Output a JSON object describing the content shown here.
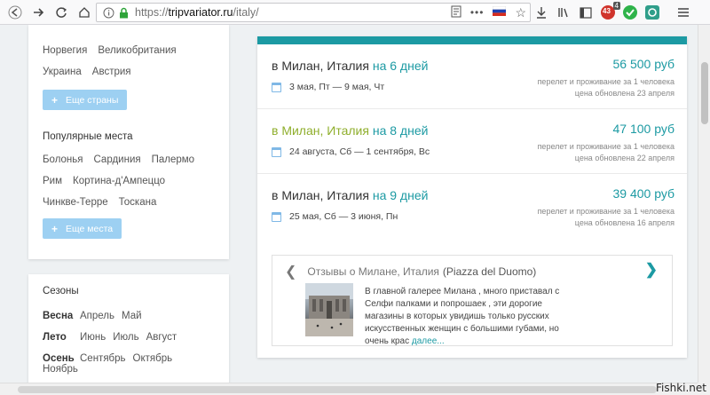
{
  "browser": {
    "url_prefix": "https://",
    "url_domain": "tripvariator.ru",
    "url_path": "/italy/",
    "badge": "4",
    "addon_count": "43"
  },
  "sidebar": {
    "countries_row1": [
      "Норвегия",
      "Великобритания"
    ],
    "countries_row2": [
      "Украина",
      "Австрия"
    ],
    "more_countries": "Еще страны",
    "popular_title": "Популярные места",
    "places_row1": [
      "Болонья",
      "Сардиния",
      "Палермо"
    ],
    "places_row2": [
      "Рим",
      "Кортина-д'Ампеццо"
    ],
    "places_row3": [
      "Чинкве-Терре",
      "Тоскана"
    ],
    "more_places": "Еще места",
    "seasons_title": "Сезоны",
    "seasons": [
      {
        "name": "Весна",
        "months": [
          "Апрель",
          "Май"
        ]
      },
      {
        "name": "Лето",
        "months": [
          "Июнь",
          "Июль",
          "Август"
        ]
      },
      {
        "name": "Осень",
        "months": [
          "Сентябрь",
          "Октябрь",
          "Ноябрь"
        ]
      }
    ]
  },
  "trips": [
    {
      "city": "в Милан, Италия",
      "days": "на 6 дней",
      "dates": "3 мая, Пт — 9 мая, Чт",
      "price": "56 500 руб",
      "meta1": "перелет и проживание за 1 человека",
      "meta2": "цена обновлена 23 апреля"
    },
    {
      "city": "в Милан, Италия",
      "days": "на 8 дней",
      "dates": "24 августа, Сб — 1 сентября, Вс",
      "price": "47 100 руб",
      "meta1": "перелет и проживание за 1 человека",
      "meta2": "цена обновлена 22 апреля"
    },
    {
      "city": "в Милан, Италия",
      "days": "на 9 дней",
      "dates": "25 мая, Сб — 3 июня, Пн",
      "price": "39 400 руб",
      "meta1": "перелет и проживание за 1 человека",
      "meta2": "цена обновлена 16 апреля"
    }
  ],
  "review": {
    "title": "Отзывы о Милане, Италия",
    "place": "(Piazza del Duomo)",
    "text": "В главной галерее Милана , много приставал с Селфи палками и попрошаек , эти дорогие магазины в которых увидишь только русских искусственных женщин с большими губами, но очень крас",
    "more": "далее..."
  },
  "watermark": "Fishki.net",
  "colors": {
    "accent": "#1c9aa3",
    "highlight_city": "#8fae2c",
    "button": "#9dd0f2"
  }
}
